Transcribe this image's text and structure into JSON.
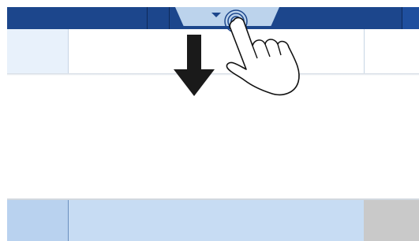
{
  "icons": {
    "down_arrow": "arrow-down-icon",
    "pull_tab_indicator": "triangle-down-icon",
    "hand": "tap-hand-icon",
    "touch_ripple": "touch-ripple-icon"
  },
  "colors": {
    "top_bar": "#1c468c",
    "pull_tab": "#bcd3ec",
    "bottom_bar": "#c7dcf3",
    "panel_light": "#e8f1fb",
    "arrow": "#1a1a1a"
  }
}
